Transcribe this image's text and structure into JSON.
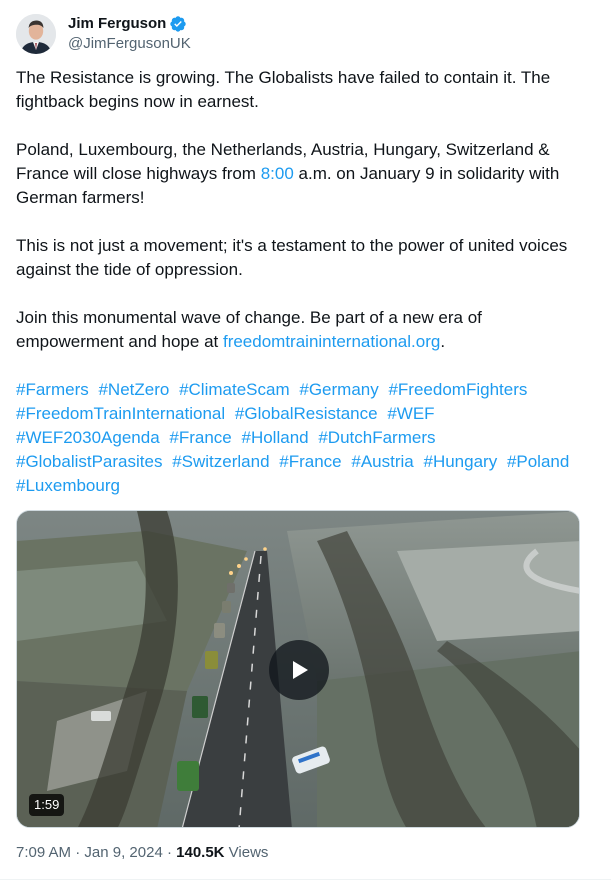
{
  "author": {
    "display_name": "Jim Ferguson",
    "handle": "@JimFergusonUK",
    "verified": true,
    "verified_color": "#1d9bf0"
  },
  "tweet": {
    "p1": "The Resistance is growing. The Globalists have failed to contain it. The fightback begins now in earnest.",
    "p2_before": "Poland, Luxembourg, the Netherlands, Austria, Hungary, Switzerland & France will close highways from ",
    "p2_time_link": "8:00",
    "p2_after": " a.m. on January 9 in solidarity with German farmers!",
    "p3": "This is not just a movement; it's a testament to the power of united voices against the tide of oppression.",
    "p4_before": "Join this monumental wave of change. Be part of a new era of empowerment and hope at ",
    "p4_link": "freedomtraininternational.org",
    "p4_after": ".",
    "hashtags": [
      "#Farmers",
      "#NetZero",
      "#ClimateScam",
      "#Germany",
      "#FreedomFighters",
      "#FreedomTrainInternational",
      "#GlobalResistance",
      "#WEF",
      "#WEF2030Agenda",
      "#France",
      "#Holland",
      "#DutchFarmers",
      "#GlobalistParasites",
      "#Switzerland",
      "#France",
      "#Austria",
      "#Hungary",
      "#Poland",
      "#Luxembourg"
    ]
  },
  "video": {
    "duration": "1:59",
    "play_icon": "play-icon"
  },
  "meta": {
    "time": "7:09 AM",
    "separator": " · ",
    "date": "Jan 9, 2024",
    "views_count": "140.5K",
    "views_label": " Views"
  },
  "colors": {
    "link": "#1d9bf0",
    "secondary_text": "#536471",
    "primary_text": "#0f1419"
  }
}
